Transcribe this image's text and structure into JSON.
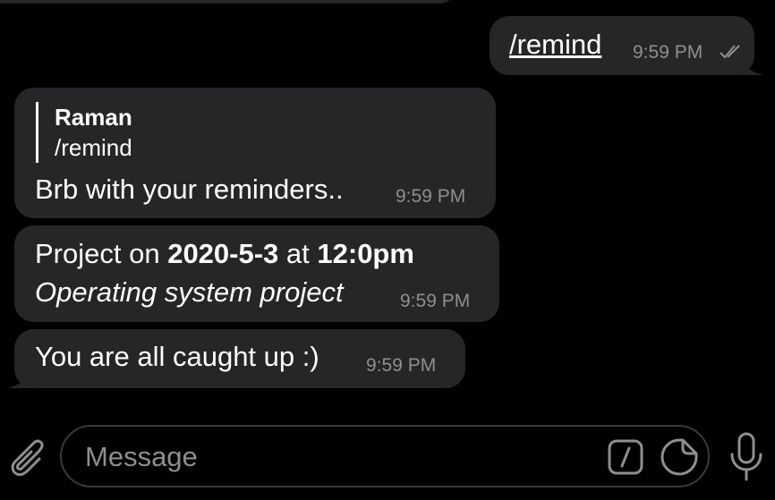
{
  "colors": {
    "background": "#000000",
    "bubble": "#262628",
    "text": "#ffffff",
    "meta": "#8e8e93"
  },
  "messages": [
    {
      "direction": "outgoing",
      "text": "/remind",
      "time": "9:59 PM",
      "status_icon": "double-check-icon"
    },
    {
      "direction": "incoming",
      "reply_to": {
        "name": "Raman",
        "text": "/remind"
      },
      "text": "Brb with your reminders..",
      "time": "9:59 PM"
    },
    {
      "direction": "incoming",
      "parts": {
        "p1": "Project on ",
        "date": "2020-5-3",
        "p2": " at ",
        "clock": "12:0pm",
        "line2": "Operating system project"
      },
      "time": "9:59 PM"
    },
    {
      "direction": "incoming",
      "text": "You are all caught up :)",
      "time": "9:59 PM"
    }
  ],
  "composer": {
    "placeholder": "Message",
    "attach_icon": "paperclip-icon",
    "commands_icon": "slash-command-icon",
    "sticker_icon": "sticker-icon",
    "mic_icon": "microphone-icon"
  }
}
